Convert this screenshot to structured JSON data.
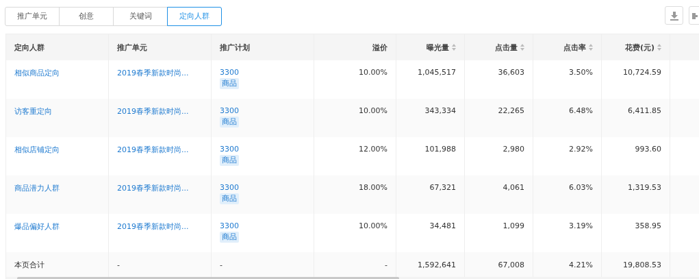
{
  "tabs": [
    {
      "label": "推广单元",
      "selected": false
    },
    {
      "label": "创意",
      "selected": false
    },
    {
      "label": "关键词",
      "selected": false
    },
    {
      "label": "定向人群",
      "selected": true
    }
  ],
  "table": {
    "columns": [
      {
        "label": "定向人群",
        "sortable": false
      },
      {
        "label": "推广单元",
        "sortable": false
      },
      {
        "label": "推广计划",
        "sortable": false
      },
      {
        "label": "溢价",
        "sortable": false
      },
      {
        "label": "曝光量",
        "sortable": true
      },
      {
        "label": "点击量",
        "sortable": true
      },
      {
        "label": "点击率",
        "sortable": true
      },
      {
        "label": "花费(元)",
        "sortable": true
      }
    ],
    "rows": [
      {
        "target": "相似商品定向",
        "unit": "2019春季新款时尚...",
        "plan": "3300",
        "tag": "商品",
        "premium": "10.00%",
        "impressions": "1,045,517",
        "clicks": "36,603",
        "ctr": "3.50%",
        "cost": "10,724.59"
      },
      {
        "target": "访客重定向",
        "unit": "2019春季新款时尚...",
        "plan": "3300",
        "tag": "商品",
        "premium": "10.00%",
        "impressions": "343,334",
        "clicks": "22,265",
        "ctr": "6.48%",
        "cost": "6,411.85"
      },
      {
        "target": "相似店铺定向",
        "unit": "2019春季新款时尚...",
        "plan": "3300",
        "tag": "商品",
        "premium": "12.00%",
        "impressions": "101,988",
        "clicks": "2,980",
        "ctr": "2.92%",
        "cost": "993.60"
      },
      {
        "target": "商品潜力人群",
        "unit": "2019春季新款时尚...",
        "plan": "3300",
        "tag": "商品",
        "premium": "18.00%",
        "impressions": "67,321",
        "clicks": "4,061",
        "ctr": "6.03%",
        "cost": "1,319.53"
      },
      {
        "target": "爆品偏好人群",
        "unit": "2019春季新款时尚...",
        "plan": "3300",
        "tag": "商品",
        "premium": "10.00%",
        "impressions": "34,481",
        "clicks": "1,099",
        "ctr": "3.19%",
        "cost": "358.95"
      }
    ],
    "summary": {
      "label": "本页合计",
      "unit": "-",
      "plan": "-",
      "premium": "-",
      "impressions": "1,592,641",
      "clicks": "67,008",
      "ctr": "4.21%",
      "cost": "19,808.53"
    }
  }
}
